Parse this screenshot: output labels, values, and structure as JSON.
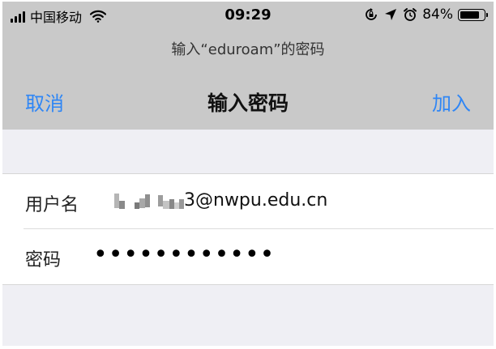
{
  "status_bar": {
    "carrier": "中国移动",
    "time": "09:29",
    "battery_percent": "84%",
    "battery_level": 0.84,
    "icons": [
      "signal-icon",
      "wifi-icon",
      "orientation-lock-icon",
      "location-icon",
      "alarm-icon",
      "battery-icon"
    ]
  },
  "prompt": "输入“eduroam”的密码",
  "navbar": {
    "cancel_label": "取消",
    "title": "输入密码",
    "join_label": "加入"
  },
  "form": {
    "username_label": "用户名",
    "username_visible_suffix": "3@nwpu.edu.cn",
    "password_label": "密码",
    "password_masked": "••••••••••••"
  },
  "colors": {
    "accent": "#2f86f5",
    "header_bg": "#c9c9c9",
    "page_bg": "#efeff4"
  }
}
